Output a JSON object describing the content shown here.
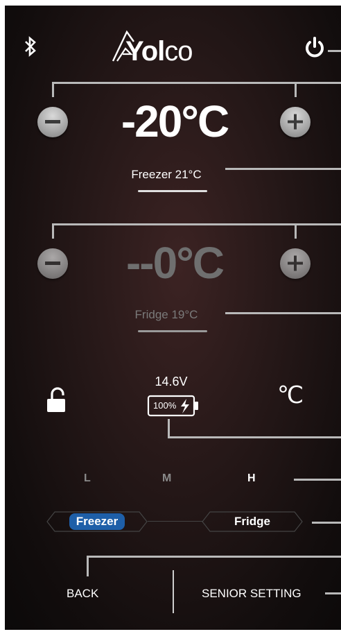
{
  "header": {
    "logo_text": "Yolco",
    "logo_bold": "Yol",
    "logo_light": "co"
  },
  "freezer": {
    "temperature": "-20°C",
    "label": "Freezer 21°C"
  },
  "fridge": {
    "temperature": "--0°C",
    "label": "Fridge 19°C"
  },
  "status": {
    "voltage": "14.6V",
    "battery_percent": "100%",
    "unit": "℃"
  },
  "levels": [
    "L",
    "M",
    "H"
  ],
  "active_level": "H",
  "zones": {
    "freezer": "Freezer",
    "fridge": "Fridge",
    "active": "Freezer"
  },
  "footer": {
    "back": "BACK",
    "senior_setting": "SENIOR SETTING"
  },
  "colors": {
    "accent": "#1e5fa8",
    "line": "#b9b9b9",
    "dim_text": "#7a7a7a"
  },
  "icons": [
    "bluetooth-icon",
    "power-icon",
    "minus-icon",
    "plus-icon",
    "unlock-icon",
    "battery-charging-icon"
  ]
}
